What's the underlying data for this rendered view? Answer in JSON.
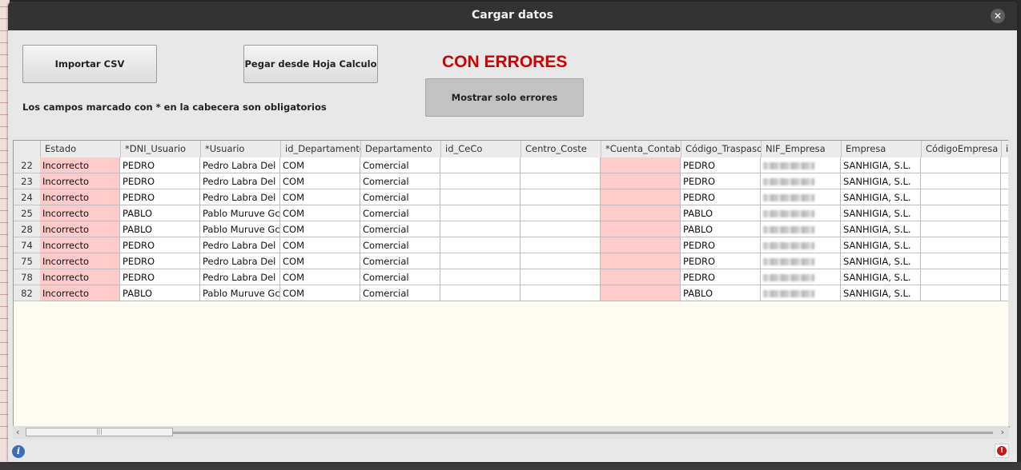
{
  "dialog": {
    "title": "Cargar datos",
    "close_icon": "close-icon"
  },
  "toolbar": {
    "import_label": "Importar CSV",
    "paste_label": "Pegar desde Hoja Calculo",
    "status_text": "CON ERRORES",
    "status_color": "#cc0000",
    "show_errors_label": "Mostrar solo errores",
    "required_note": "Los campos marcado con * en la cabecera son obligatorios"
  },
  "table": {
    "columns": [
      "Estado",
      "*DNI_Usuario",
      "*Usuario",
      "id_Departamento",
      "Departamento",
      "id_CeCo",
      "Centro_Coste",
      "*Cuenta_Contab",
      "Código_Traspaso",
      "NIF_Empresa",
      "Empresa",
      "CódigoEmpresa",
      "i"
    ],
    "error_color": "#ffcaca",
    "rows": [
      {
        "num": "22",
        "cells": [
          "Incorrecto",
          "PEDRO",
          "Pedro Labra Del",
          "COM",
          "Comercial",
          "",
          "",
          "",
          "PEDRO",
          "",
          "SANHIGIA, S.L.",
          ""
        ]
      },
      {
        "num": "23",
        "cells": [
          "Incorrecto",
          "PEDRO",
          "Pedro Labra Del",
          "COM",
          "Comercial",
          "",
          "",
          "",
          "PEDRO",
          "",
          "SANHIGIA, S.L.",
          ""
        ]
      },
      {
        "num": "24",
        "cells": [
          "Incorrecto",
          "PEDRO",
          "Pedro Labra Del",
          "COM",
          "Comercial",
          "",
          "",
          "",
          "PEDRO",
          "",
          "SANHIGIA, S.L.",
          ""
        ]
      },
      {
        "num": "25",
        "cells": [
          "Incorrecto",
          "PABLO",
          "Pablo Muruve Gc",
          "COM",
          "Comercial",
          "",
          "",
          "",
          "PABLO",
          "",
          "SANHIGIA, S.L.",
          ""
        ]
      },
      {
        "num": "28",
        "cells": [
          "Incorrecto",
          "PABLO",
          "Pablo Muruve Gc",
          "COM",
          "Comercial",
          "",
          "",
          "",
          "PABLO",
          "",
          "SANHIGIA, S.L.",
          ""
        ]
      },
      {
        "num": "74",
        "cells": [
          "Incorrecto",
          "PEDRO",
          "Pedro Labra Del",
          "COM",
          "Comercial",
          "",
          "",
          "",
          "PEDRO",
          "",
          "SANHIGIA, S.L.",
          ""
        ]
      },
      {
        "num": "75",
        "cells": [
          "Incorrecto",
          "PEDRO",
          "Pedro Labra Del",
          "COM",
          "Comercial",
          "",
          "",
          "",
          "PEDRO",
          "",
          "SANHIGIA, S.L.",
          ""
        ]
      },
      {
        "num": "78",
        "cells": [
          "Incorrecto",
          "PEDRO",
          "Pedro Labra Del",
          "COM",
          "Comercial",
          "",
          "",
          "",
          "PEDRO",
          "",
          "SANHIGIA, S.L.",
          ""
        ]
      },
      {
        "num": "82",
        "cells": [
          "Incorrecto",
          "PABLO",
          "Pablo Muruve Gc",
          "COM",
          "Comercial",
          "",
          "",
          "",
          "PABLO",
          "",
          "SANHIGIA, S.L.",
          ""
        ]
      }
    ]
  },
  "footer": {
    "info_icon": "info-icon",
    "error_icon": "error-icon"
  }
}
